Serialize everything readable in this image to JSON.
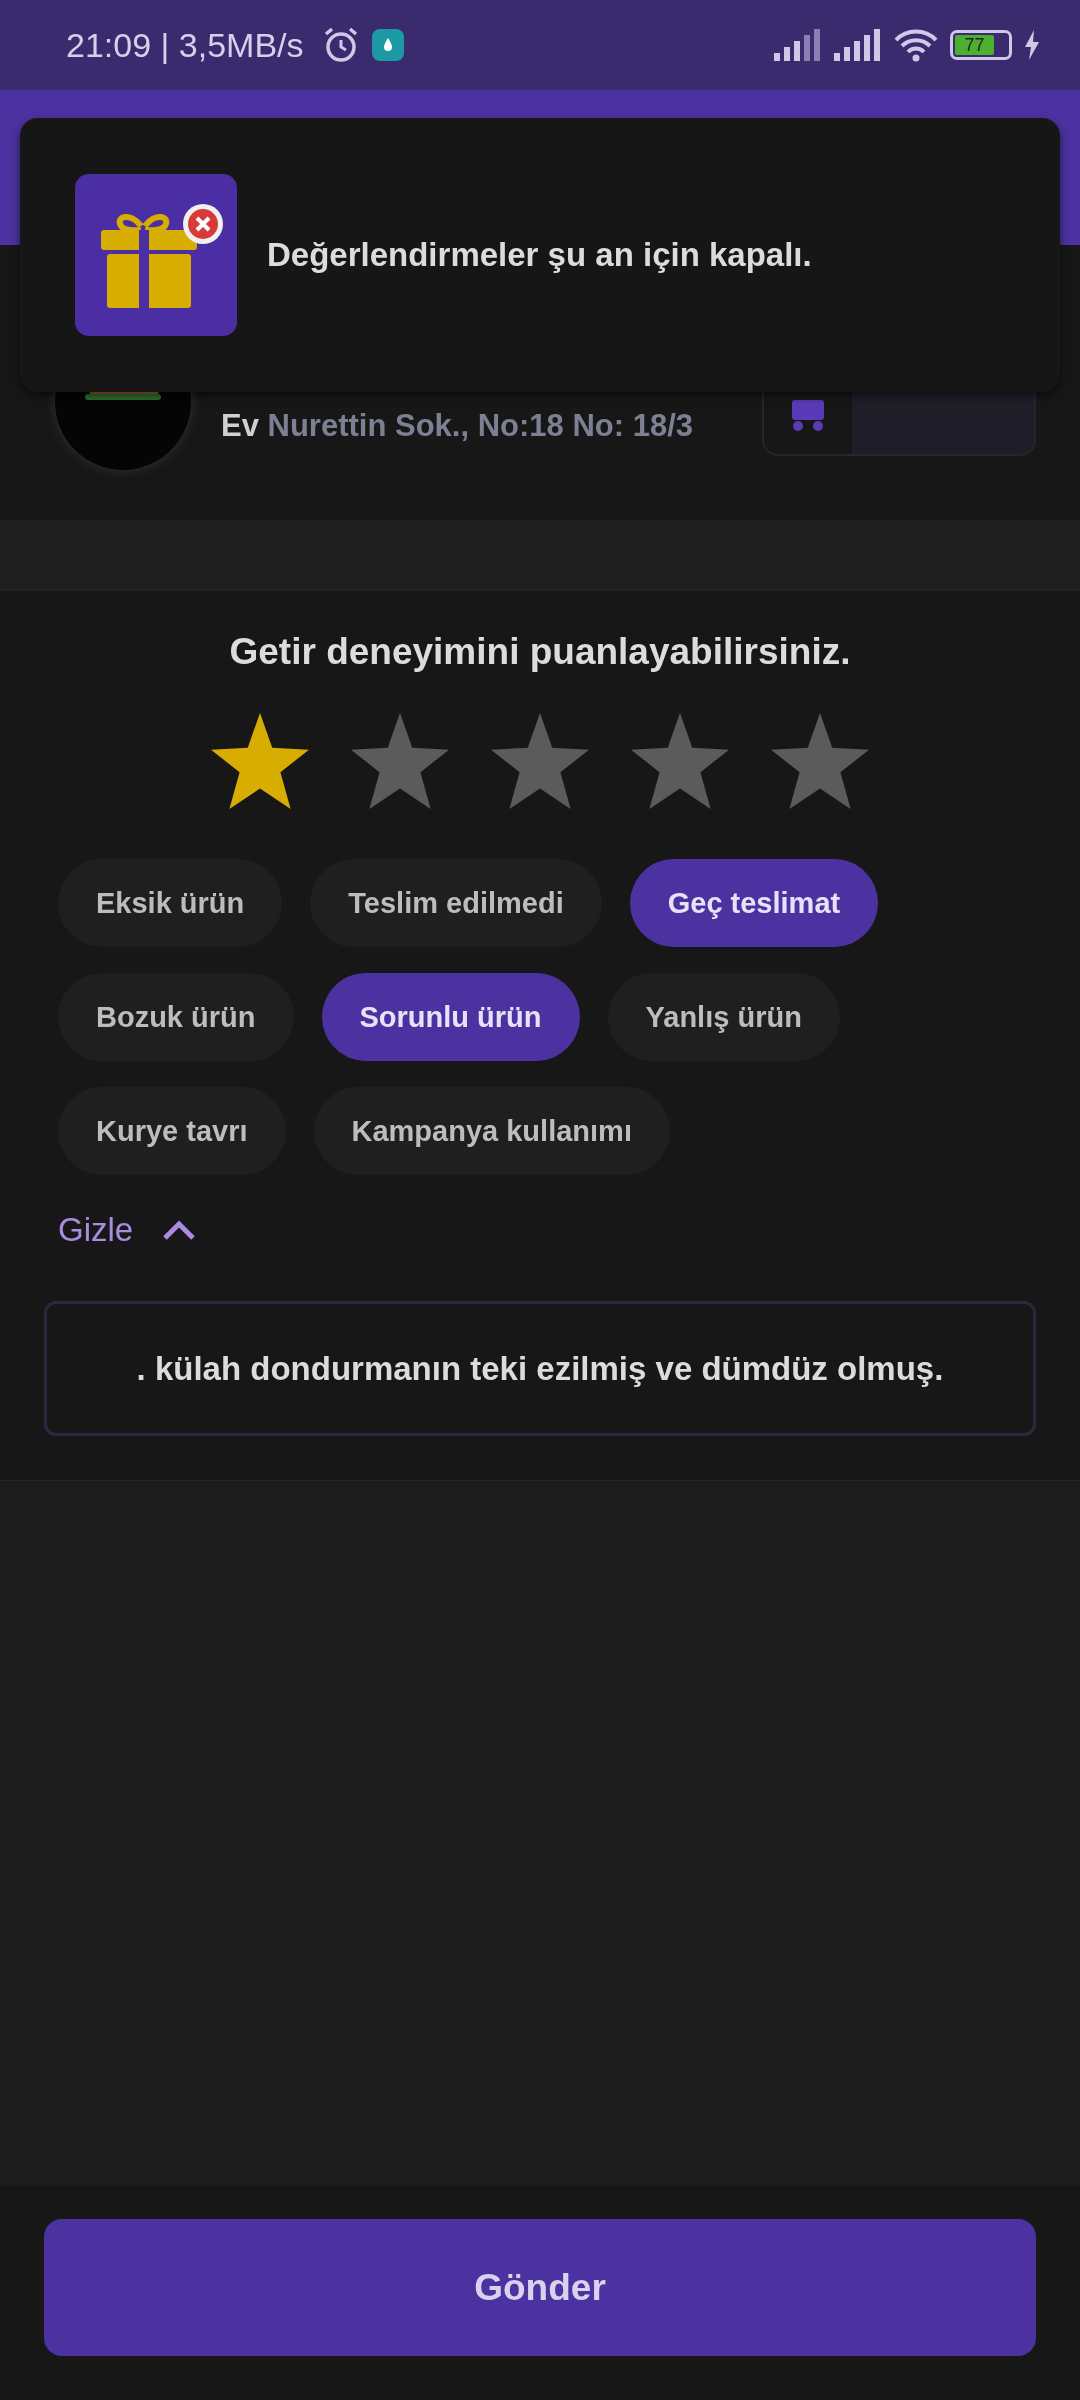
{
  "status_bar": {
    "time": "21:09 | 3,5MB/s",
    "battery": "77"
  },
  "toast": {
    "message": "Değerlendirmeler şu an için kapalı."
  },
  "order": {
    "address_label": "Ev",
    "address": "Nurettin Sok., No:18 No: 18/3"
  },
  "rating": {
    "prompt": "Getir deneyimini puanlayabilirsiniz.",
    "stars": 1
  },
  "reasons": [
    {
      "label": "Eksik ürün",
      "selected": false
    },
    {
      "label": "Teslim edilmedi",
      "selected": false
    },
    {
      "label": "Geç teslimat",
      "selected": true
    },
    {
      "label": "Bozuk ürün",
      "selected": false
    },
    {
      "label": "Sorunlu ürün",
      "selected": true
    },
    {
      "label": "Yanlış ürün",
      "selected": false
    },
    {
      "label": "Kurye tavrı",
      "selected": false
    },
    {
      "label": "Kampanya kullanımı",
      "selected": false
    }
  ],
  "toggle": {
    "label": "Gizle",
    "expanded": true
  },
  "comment": {
    "value": ". külah dondurmanın teki ezilmiş ve dümdüz olmuş."
  },
  "submit": {
    "label": "Gönder"
  }
}
